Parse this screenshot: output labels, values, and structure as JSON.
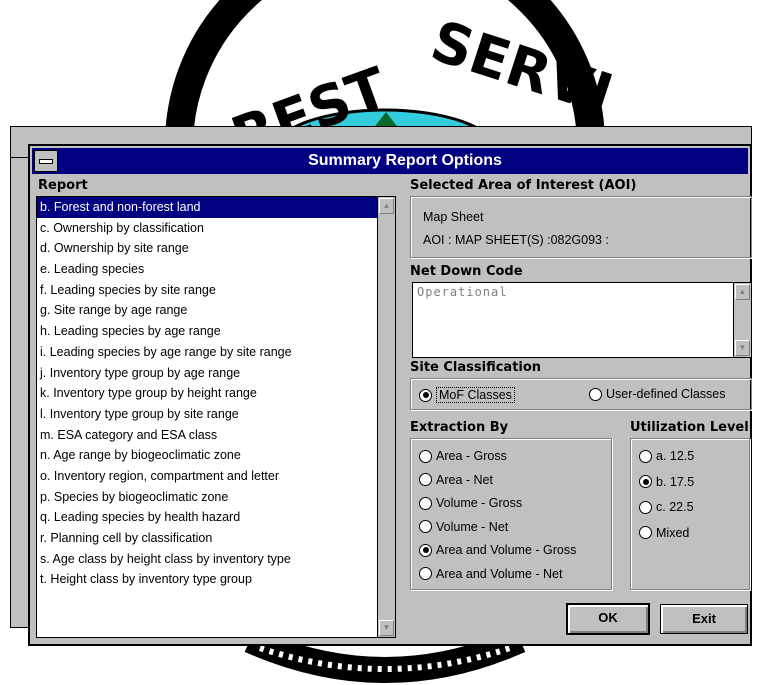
{
  "background": {
    "logo_text": "FOREST SERVICE"
  },
  "dialog": {
    "title": "Summary Report Options",
    "report_label": "Report",
    "report_items": [
      {
        "label": "b. Forest and non-forest land",
        "selected": true
      },
      {
        "label": "c. Ownership by classification"
      },
      {
        "label": "d. Ownership by site range"
      },
      {
        "label": "e. Leading species"
      },
      {
        "label": "f. Leading species by site range"
      },
      {
        "label": "g. Site range by age range"
      },
      {
        "label": "h. Leading species by age range"
      },
      {
        "label": "i. Leading species by age range by site range"
      },
      {
        "label": "j. Inventory type group by age range"
      },
      {
        "label": "k. Inventory type group by height range"
      },
      {
        "label": "l. Inventory type group by site range"
      },
      {
        "label": "m. ESA category and ESA class"
      },
      {
        "label": "n. Age range by biogeoclimatic zone"
      },
      {
        "label": "o. Inventory region, compartment and letter"
      },
      {
        "label": "p. Species by biogeoclimatic zone"
      },
      {
        "label": "q. Leading species by health hazard"
      },
      {
        "label": "r. Planning cell by classification"
      },
      {
        "label": "s. Age class by height class by inventory type"
      },
      {
        "label": "t. Height class by inventory type group"
      }
    ],
    "aoi": {
      "label": "Selected Area of Interest (AOI)",
      "line1": "Map Sheet",
      "line2": "AOI : MAP SHEET(S) :082G093 :"
    },
    "net_down": {
      "label": "Net Down Code",
      "value": "Operational"
    },
    "site_classification": {
      "label": "Site Classification",
      "options": [
        {
          "label": "MoF Classes",
          "checked": true
        },
        {
          "label": "User-defined Classes",
          "checked": false
        }
      ]
    },
    "extraction": {
      "label": "Extraction By",
      "options": [
        {
          "label": "Area - Gross",
          "checked": false
        },
        {
          "label": "Area - Net",
          "checked": false
        },
        {
          "label": "Volume - Gross",
          "checked": false
        },
        {
          "label": "Volume - Net",
          "checked": false
        },
        {
          "label": "Area and Volume - Gross",
          "checked": true
        },
        {
          "label": "Area and Volume - Net",
          "checked": false
        }
      ]
    },
    "utilization": {
      "label": "Utilization Level",
      "options": [
        {
          "label": "a. 12.5",
          "checked": false
        },
        {
          "label": "b. 17.5",
          "checked": true
        },
        {
          "label": "c. 22.5",
          "checked": false
        },
        {
          "label": "Mixed",
          "checked": false
        }
      ]
    },
    "buttons": {
      "ok": "OK",
      "exit": "Exit"
    }
  }
}
